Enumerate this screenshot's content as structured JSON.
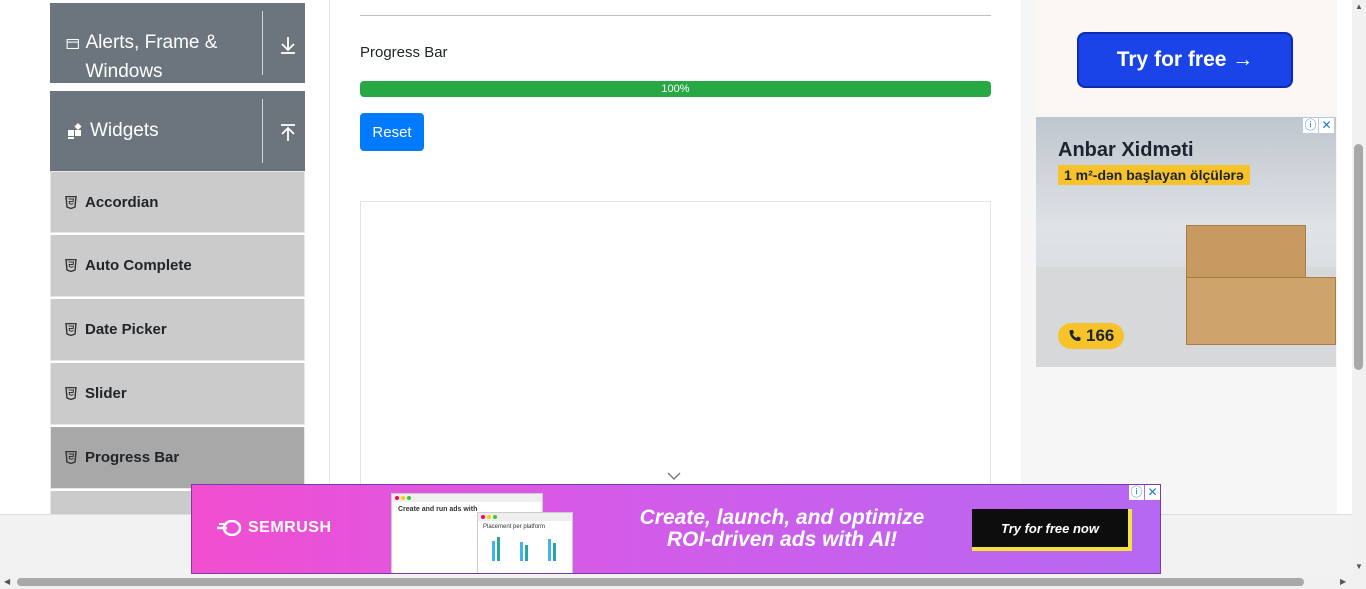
{
  "sidebar": {
    "groups": [
      {
        "label": "Alerts, Frame & Windows",
        "icon": "window-icon",
        "toggle_icon": "arrow-down-icon"
      },
      {
        "label": "Widgets",
        "icon": "widgets-icon",
        "toggle_icon": "arrow-up-icon"
      }
    ],
    "items": [
      {
        "label": "Accordian",
        "active": false
      },
      {
        "label": "Auto Complete",
        "active": false
      },
      {
        "label": "Date Picker",
        "active": false
      },
      {
        "label": "Slider",
        "active": false
      },
      {
        "label": "Progress Bar",
        "active": true
      }
    ]
  },
  "main": {
    "progress": {
      "label": "Progress Bar",
      "value_text": "100%",
      "percent": 100,
      "fill_color": "#28a745"
    },
    "reset_label": "Reset"
  },
  "ads": {
    "try_free": "Try for free →",
    "warehouse": {
      "title": "Anbar Xidməti",
      "subtitle": "1 m²-dən başlayan ölçülərə",
      "phone": "166"
    },
    "banner": {
      "brand": "SEMRUSH",
      "mock1_title": "Create and run ads with",
      "mock2_title": "Placement per platform",
      "headline_line1": "Create, launch, and optimize",
      "headline_line2": "ROI-driven ads with AI!",
      "cta": "Try for free now"
    }
  },
  "colors": {
    "sidebar_group": "#6c757d",
    "menu_item": "#cbcbcb",
    "menu_item_active": "#a8a8a8",
    "reset_button": "#007bff"
  }
}
